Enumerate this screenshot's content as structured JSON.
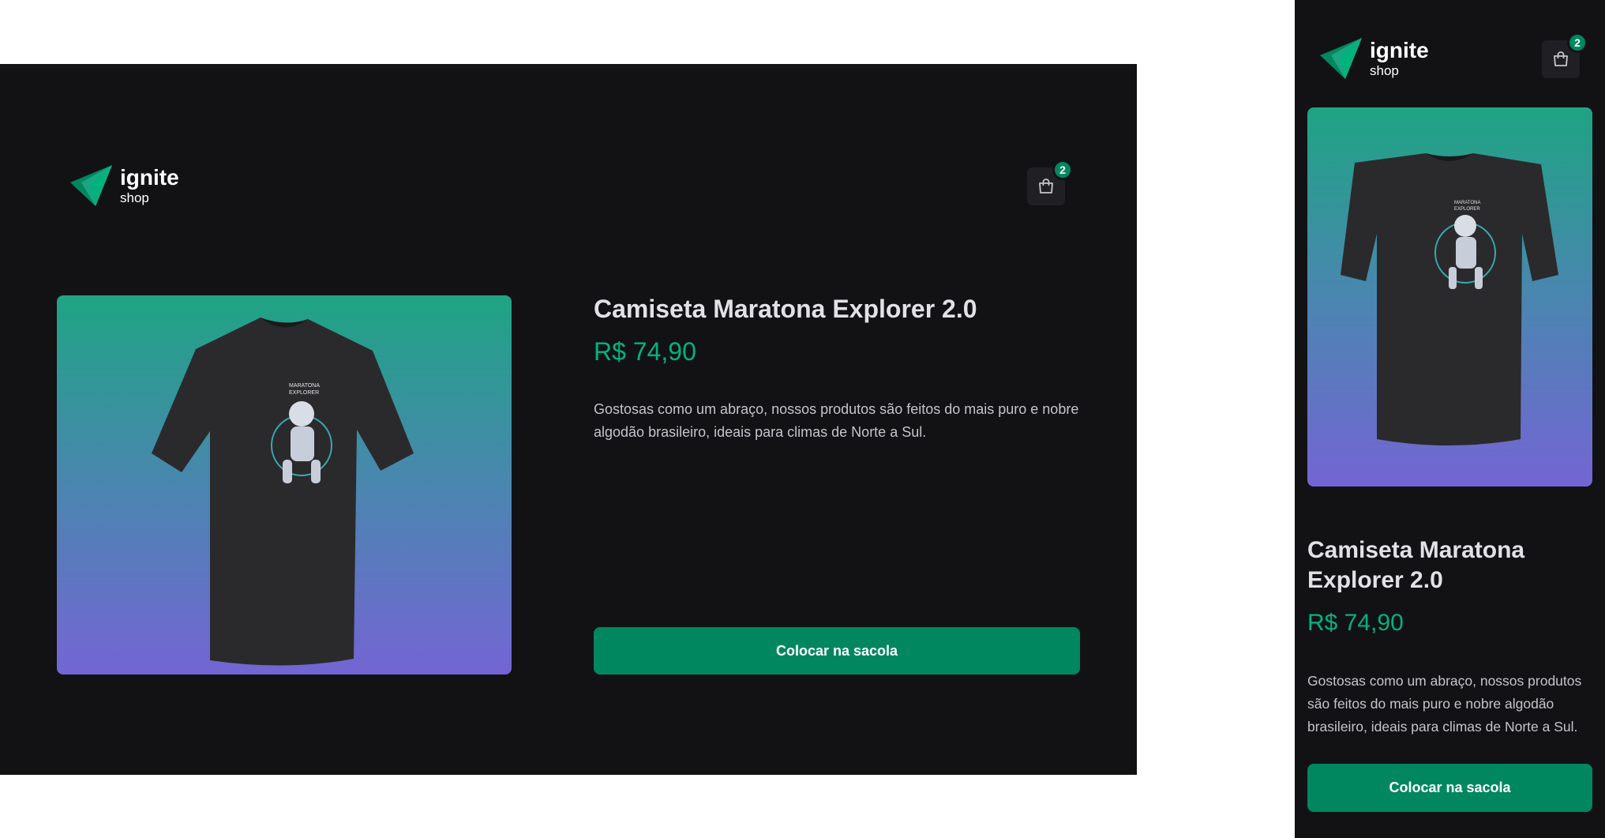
{
  "brand": {
    "name": "ignite",
    "sub": "shop"
  },
  "cart": {
    "count": "2",
    "icon": "shopping-bag-icon"
  },
  "product": {
    "title": "Camiseta Maratona Explorer 2.0",
    "price": "R$ 74,90",
    "description": "Gostosas como um abraço, nossos produtos são feitos do mais puro e nobre algodão brasileiro, ideais para climas de Norte a Sul.",
    "button_label": "Colocar na sacola",
    "shirt_print_line1": "MARATONA",
    "shirt_print_line2": "EXPLORER"
  },
  "colors": {
    "background": "#121214",
    "accent": "#00875f",
    "price": "#00b37e",
    "gradient_top": "#1ea483",
    "gradient_bottom": "#7465d4"
  }
}
